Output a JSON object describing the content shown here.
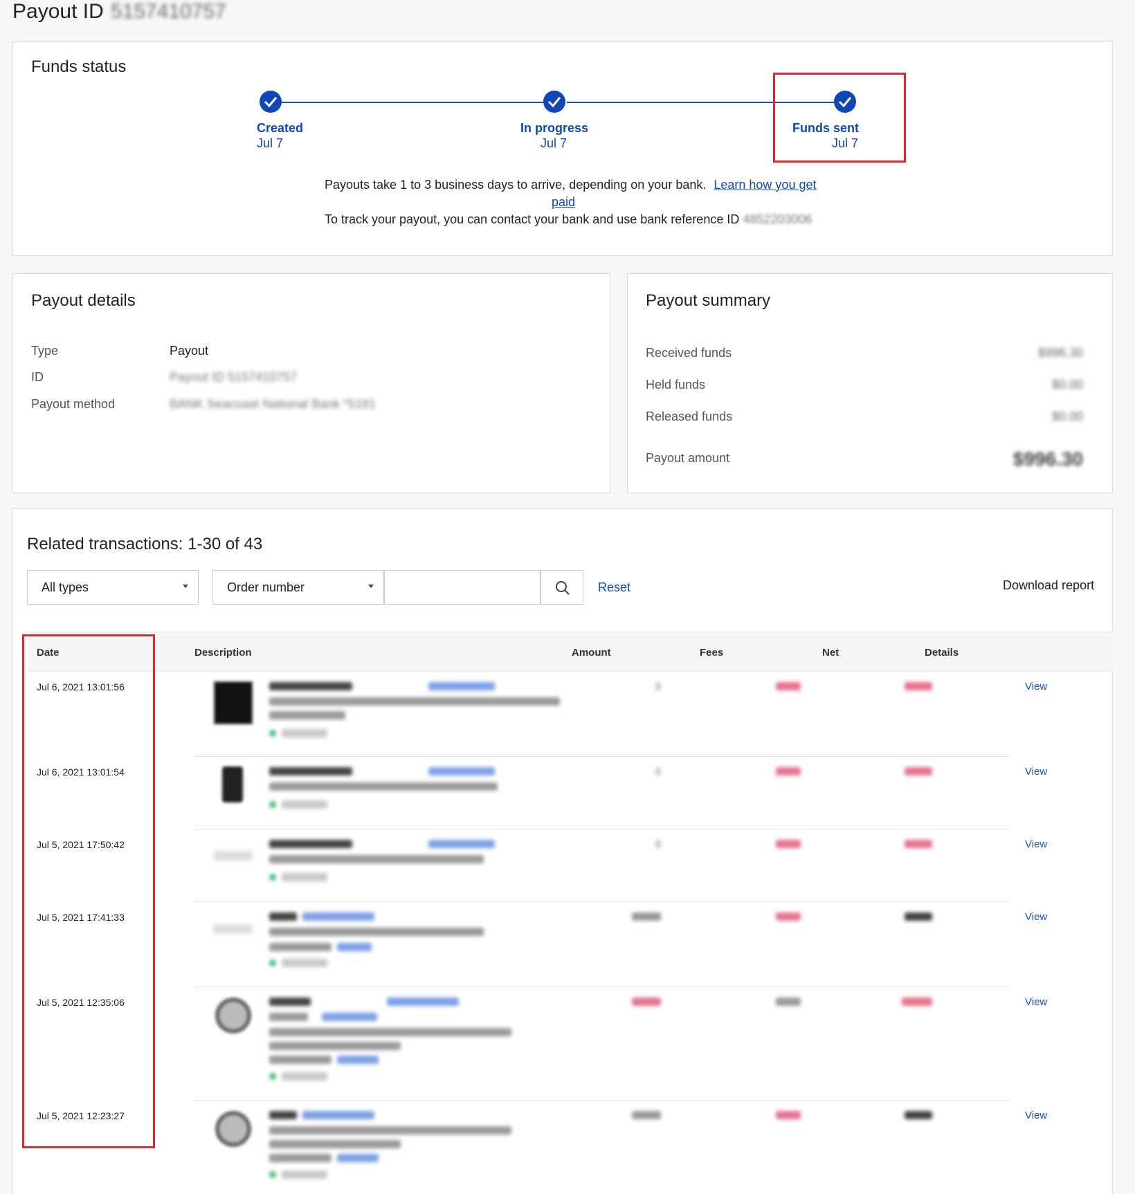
{
  "page": {
    "title": "Payout ID",
    "payout_id": "5157410757"
  },
  "funds_status": {
    "title": "Funds status",
    "steps": [
      {
        "label": "Created",
        "date": "Jul 7"
      },
      {
        "label": "In progress",
        "date": "Jul 7"
      },
      {
        "label": "Funds sent",
        "date": "Jul 7"
      }
    ],
    "info_line1": "Payouts take 1 to 3 business days to arrive, depending on your bank.",
    "learn_link_part1": "Learn how you get",
    "learn_link_part2": "paid",
    "info_line2": "To track your payout, you can contact your bank and use bank reference ID",
    "bank_reference": "4852203006"
  },
  "payout_details": {
    "title": "Payout details",
    "rows": [
      {
        "label": "Type",
        "value": "Payout"
      },
      {
        "label": "ID",
        "value": "Payout ID 5157410757"
      },
      {
        "label": "Payout method",
        "value": "BANK Seacoast National Bank *5181"
      }
    ]
  },
  "payout_summary": {
    "title": "Payout summary",
    "rows": [
      {
        "label": "Received funds",
        "value": "$996.30"
      },
      {
        "label": "Held funds",
        "value": "$0.00"
      },
      {
        "label": "Released funds",
        "value": "$0.00"
      },
      {
        "label": "Payout amount",
        "value": "$996.30"
      }
    ]
  },
  "transactions": {
    "title": "Related transactions: 1-30 of 43",
    "filter_type": "All types",
    "filter_field": "Order number",
    "search_value": "",
    "reset_label": "Reset",
    "download_label": "Download report",
    "columns": [
      "Date",
      "Description",
      "Amount",
      "Fees",
      "Net",
      "Details"
    ],
    "rows": [
      {
        "date": "Jul 6, 2021 13:01:56",
        "details": "View"
      },
      {
        "date": "Jul 6, 2021 13:01:54",
        "details": "View"
      },
      {
        "date": "Jul 5, 2021 17:50:42",
        "details": "View"
      },
      {
        "date": "Jul 5, 2021 17:41:33",
        "details": "View"
      },
      {
        "date": "Jul 5, 2021 12:35:06",
        "details": "View"
      },
      {
        "date": "Jul 5, 2021 12:23:27",
        "details": "View"
      }
    ]
  },
  "colors": {
    "accent": "#0f47b4",
    "highlight": "#e0272f",
    "link": "#1b4fb7"
  },
  "icons": [
    "check-icon",
    "search-icon",
    "caret-down-icon"
  ]
}
